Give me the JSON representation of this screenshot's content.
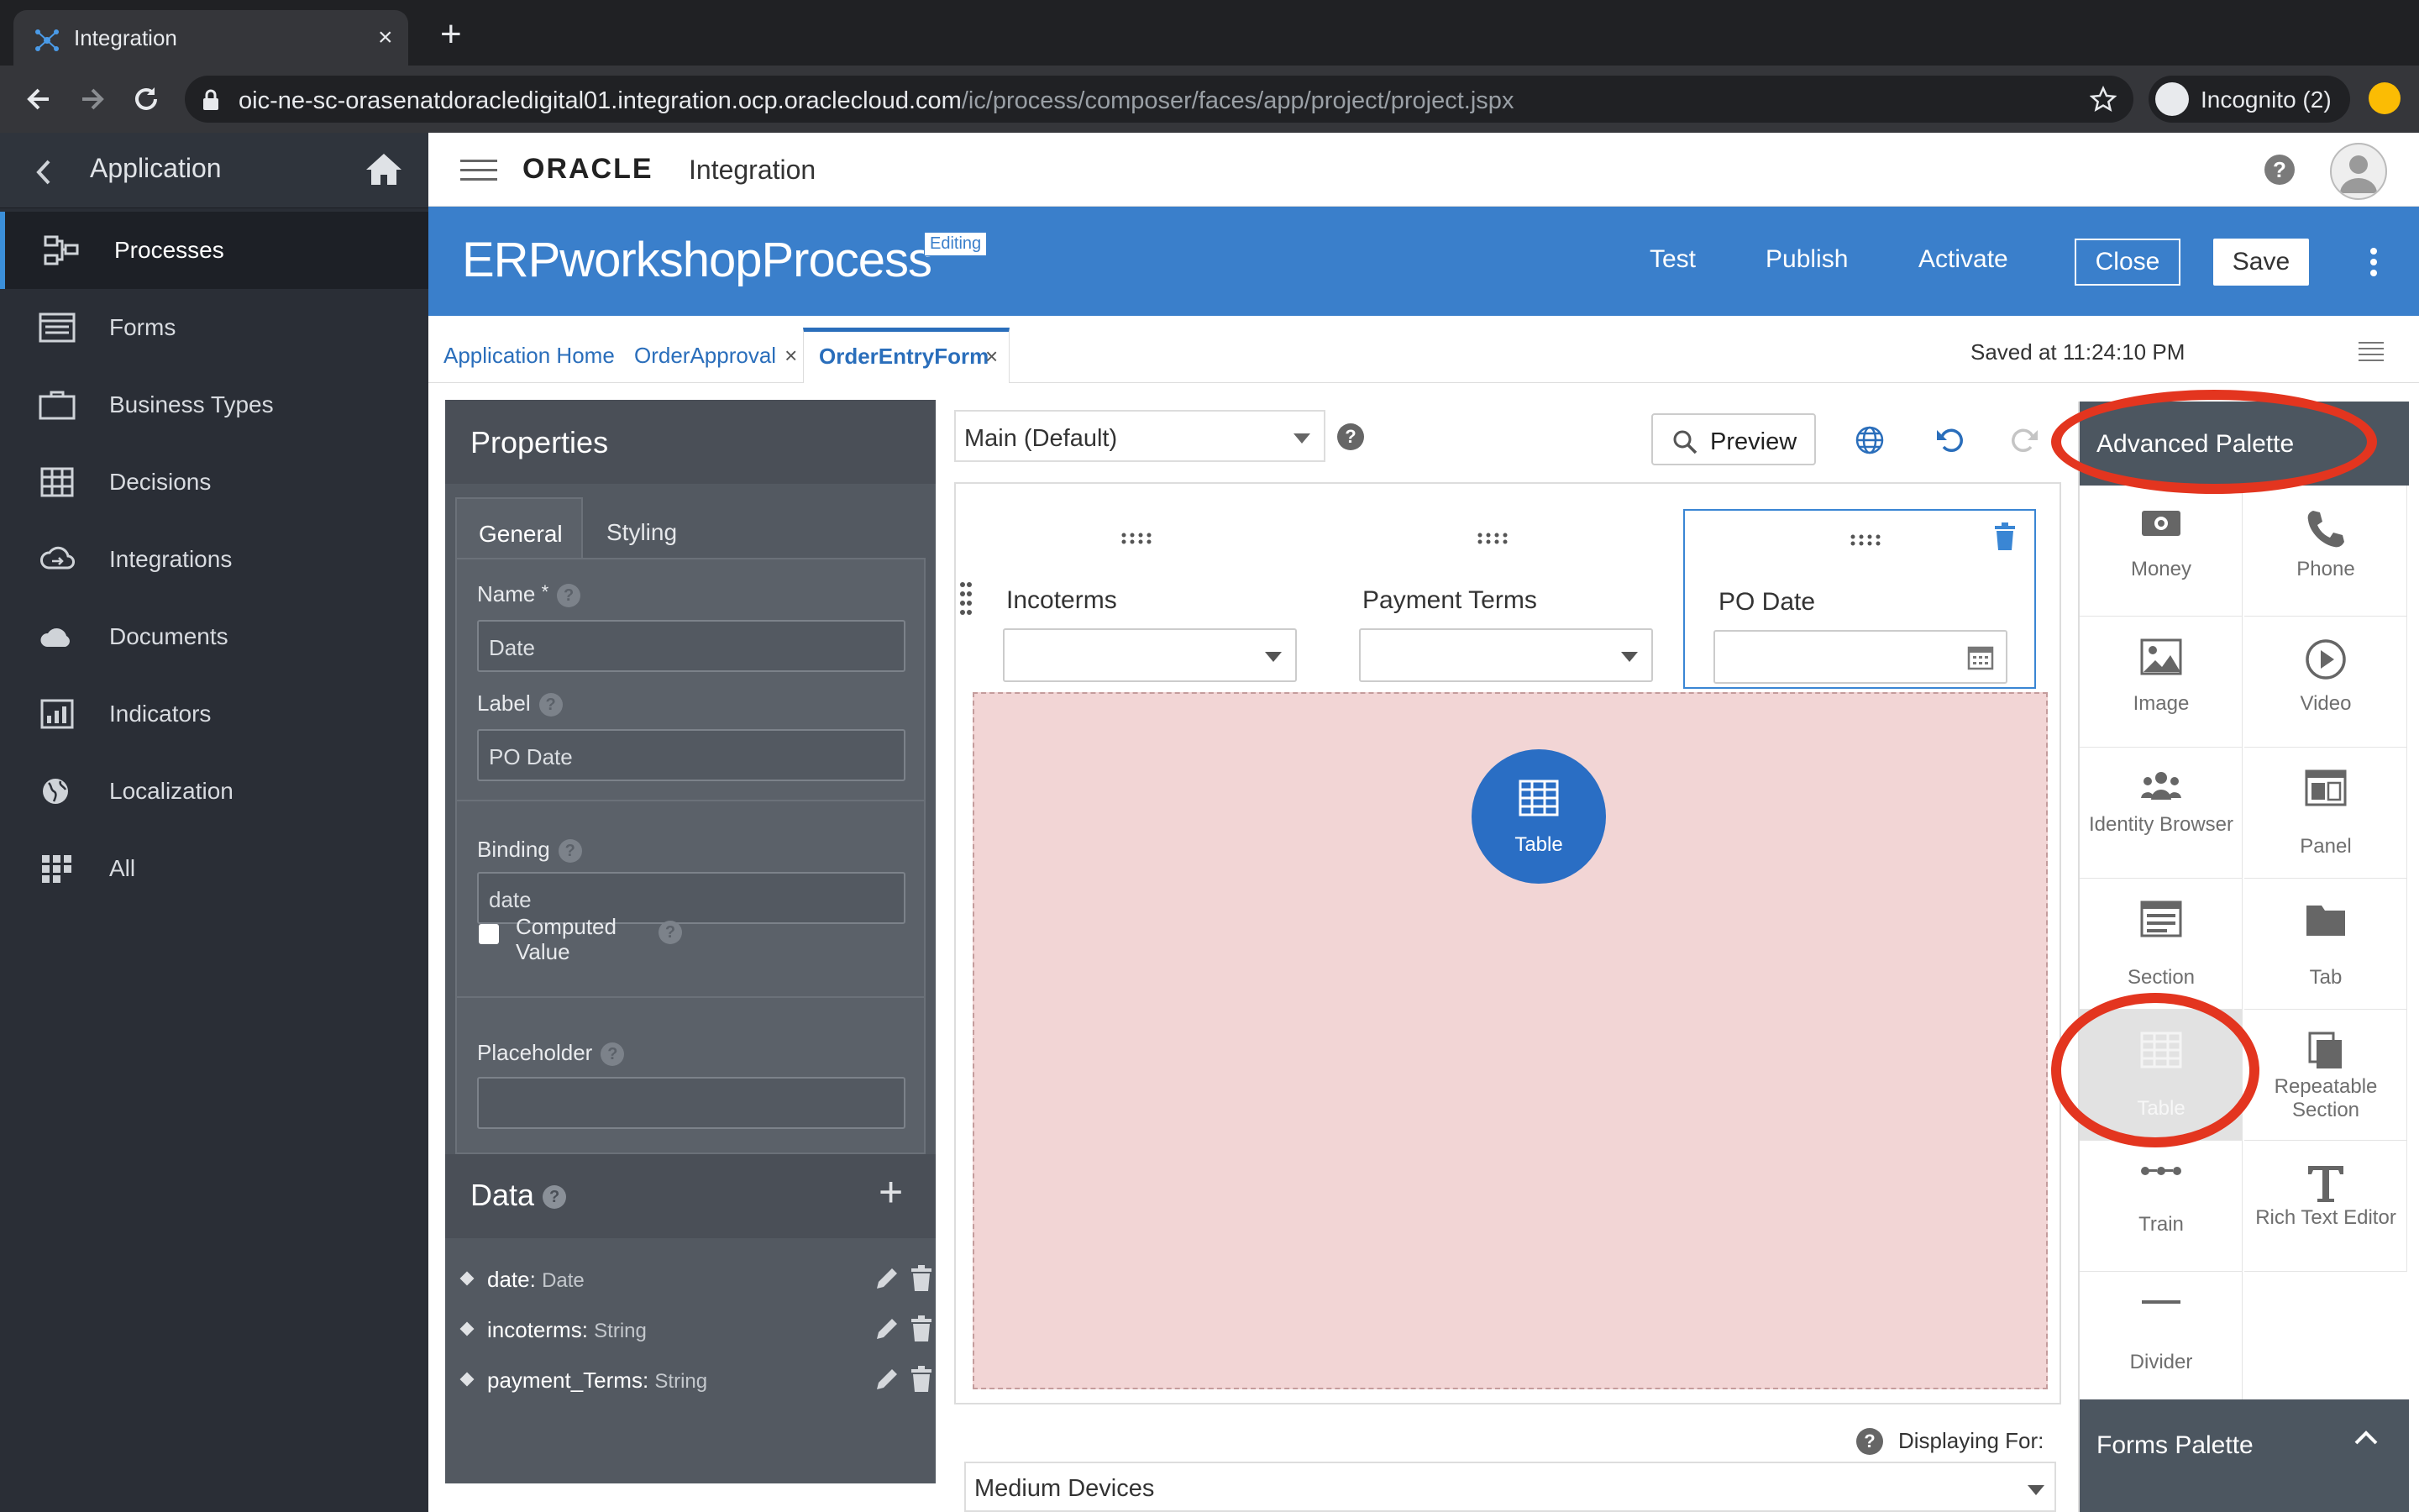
{
  "browser": {
    "tab_title": "Integration",
    "tab_close": "×",
    "new_tab": "+",
    "url_host": "oic-ne-sc-orasenatdoracledigital01.integration.ocp.oraclecloud.com",
    "url_path": "/ic/process/composer/faces/app/project/project.jspx",
    "incognito_label": "Incognito (2)"
  },
  "sidebar": {
    "title": "Application",
    "items": [
      {
        "label": "Processes",
        "icon": "processes-icon",
        "active": true
      },
      {
        "label": "Forms",
        "icon": "forms-icon"
      },
      {
        "label": "Business Types",
        "icon": "business-types-icon"
      },
      {
        "label": "Decisions",
        "icon": "decisions-icon"
      },
      {
        "label": "Integrations",
        "icon": "integrations-icon"
      },
      {
        "label": "Documents",
        "icon": "documents-icon"
      },
      {
        "label": "Indicators",
        "icon": "indicators-icon"
      },
      {
        "label": "Localization",
        "icon": "localization-icon"
      },
      {
        "label": "All",
        "icon": "all-icon"
      }
    ]
  },
  "header": {
    "brand": "ORACLE",
    "product": "Integration",
    "help": "?"
  },
  "banner": {
    "title": "ERPworkshopProcess",
    "badge": "Editing",
    "test": "Test",
    "publish": "Publish",
    "activate": "Activate",
    "close": "Close",
    "save": "Save"
  },
  "tabs": {
    "items": [
      {
        "label": "Application Home",
        "closable": false
      },
      {
        "label": "OrderApproval",
        "closable": true
      },
      {
        "label": "OrderEntryForm",
        "closable": true,
        "active": true
      }
    ],
    "close_glyph": "×",
    "saved_at": "Saved at 11:24:10 PM"
  },
  "properties": {
    "title": "Properties",
    "tab_general": "General",
    "tab_styling": "Styling",
    "name_label": "Name",
    "required_mark": "*",
    "name_value": "Date",
    "label_label": "Label",
    "label_value": "PO Date",
    "binding_label": "Binding",
    "binding_value": "date",
    "computed_label": "Computed Value",
    "computed_checked": false,
    "placeholder_label": "Placeholder",
    "placeholder_value": "",
    "help": "?"
  },
  "data": {
    "title": "Data",
    "add": "+",
    "items": [
      {
        "name": "date:",
        "type": "Date"
      },
      {
        "name": "incoterms:",
        "type": "String"
      },
      {
        "name": "payment_Terms:",
        "type": "String"
      }
    ]
  },
  "canvas": {
    "variant": "Main (Default)",
    "preview": "Preview",
    "fields": [
      {
        "label": "Incoterms",
        "kind": "select"
      },
      {
        "label": "Payment Terms",
        "kind": "select"
      },
      {
        "label": "PO Date",
        "kind": "date",
        "selected": true
      }
    ],
    "drop_label": "Table",
    "displaying_for": "Displaying For:",
    "device": "Medium Devices"
  },
  "palette": {
    "title": "Advanced Palette",
    "items": [
      {
        "label": "Money",
        "icon": "money-icon"
      },
      {
        "label": "Phone",
        "icon": "phone-icon"
      },
      {
        "label": "Image",
        "icon": "image-icon"
      },
      {
        "label": "Video",
        "icon": "video-icon"
      },
      {
        "label": "Identity Browser",
        "icon": "identity-browser-icon"
      },
      {
        "label": "Panel",
        "icon": "panel-icon"
      },
      {
        "label": "Section",
        "icon": "section-icon"
      },
      {
        "label": "Tab",
        "icon": "tab-icon"
      },
      {
        "label": "Table",
        "icon": "table-icon",
        "highlighted": true
      },
      {
        "label": "Repeatable Section",
        "icon": "repeatable-section-icon"
      },
      {
        "label": "Train",
        "icon": "train-icon"
      },
      {
        "label": "Rich Text Editor",
        "icon": "rich-text-editor-icon"
      },
      {
        "label": "Divider",
        "icon": "divider-icon"
      }
    ],
    "forms_palette": "Forms Palette"
  },
  "colors": {
    "banner": "#3a7fcb",
    "sidebar": "#2a2e36",
    "drop_zone": "#f2d5d5",
    "annotation": "#e3351f"
  }
}
